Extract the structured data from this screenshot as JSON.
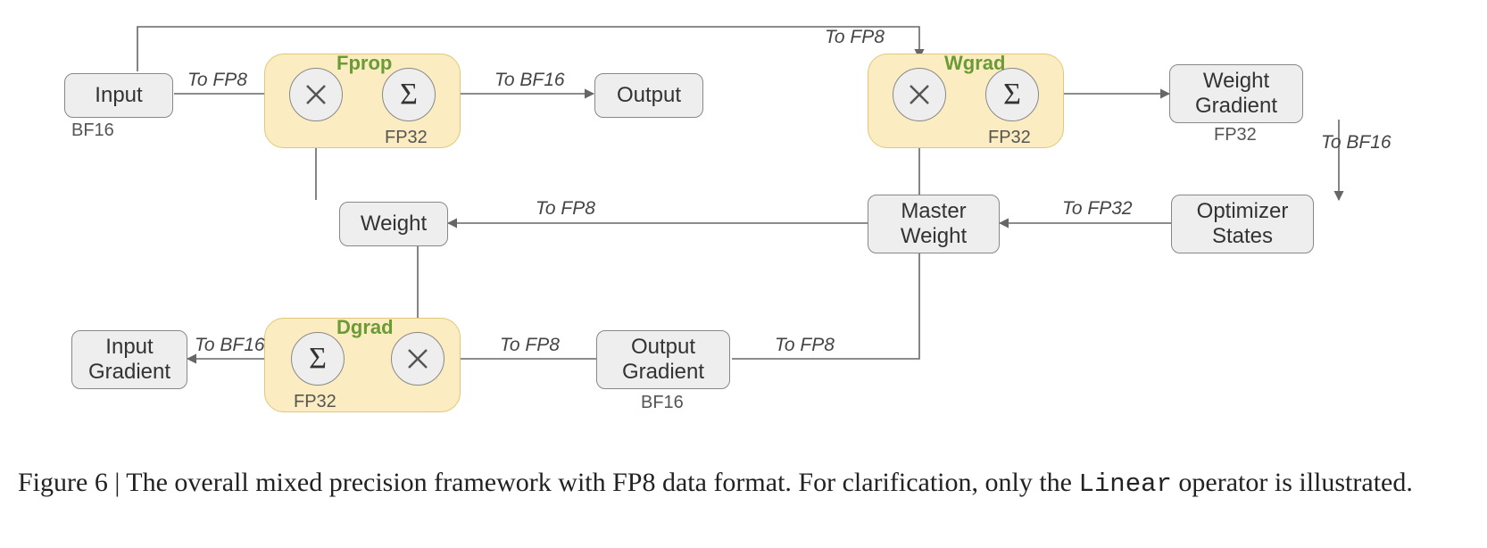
{
  "nodes": {
    "input": {
      "label": "Input",
      "dtype": "BF16"
    },
    "output": {
      "label": "Output"
    },
    "weight": {
      "label": "Weight"
    },
    "input_gradient": {
      "label": "Input\nGradient"
    },
    "output_gradient": {
      "label": "Output\nGradient",
      "dtype": "BF16"
    },
    "master_weight": {
      "label": "Master\nWeight"
    },
    "weight_gradient": {
      "label": "Weight\nGradient",
      "dtype": "FP32"
    },
    "optimizer_states": {
      "label": "Optimizer\nStates"
    }
  },
  "ops": {
    "fprop": {
      "title": "Fprop",
      "accum": "FP32"
    },
    "wgrad": {
      "title": "Wgrad",
      "accum": "FP32"
    },
    "dgrad": {
      "title": "Dgrad",
      "accum": "FP32"
    }
  },
  "edge_labels": {
    "input_to_fprop": "To FP8",
    "input_to_wgrad": "To FP8",
    "fprop_to_output": "To BF16",
    "weight_to_fprop": "",
    "weight_to_dgrad": "",
    "master_to_weight": "To FP8",
    "outgrad_to_dgrad": "To FP8",
    "outgrad_to_wgrad": "To FP8",
    "dgrad_to_ingrad": "To BF16",
    "wgrad_to_weightgrad": "",
    "weightgrad_to_opt": "To BF16",
    "opt_to_master": "To FP32"
  },
  "caption": {
    "prefix": "Figure 6 | The overall mixed precision framework with FP8 data format. For clarification, only the ",
    "code": "Linear",
    "suffix": " operator is illustrated."
  }
}
